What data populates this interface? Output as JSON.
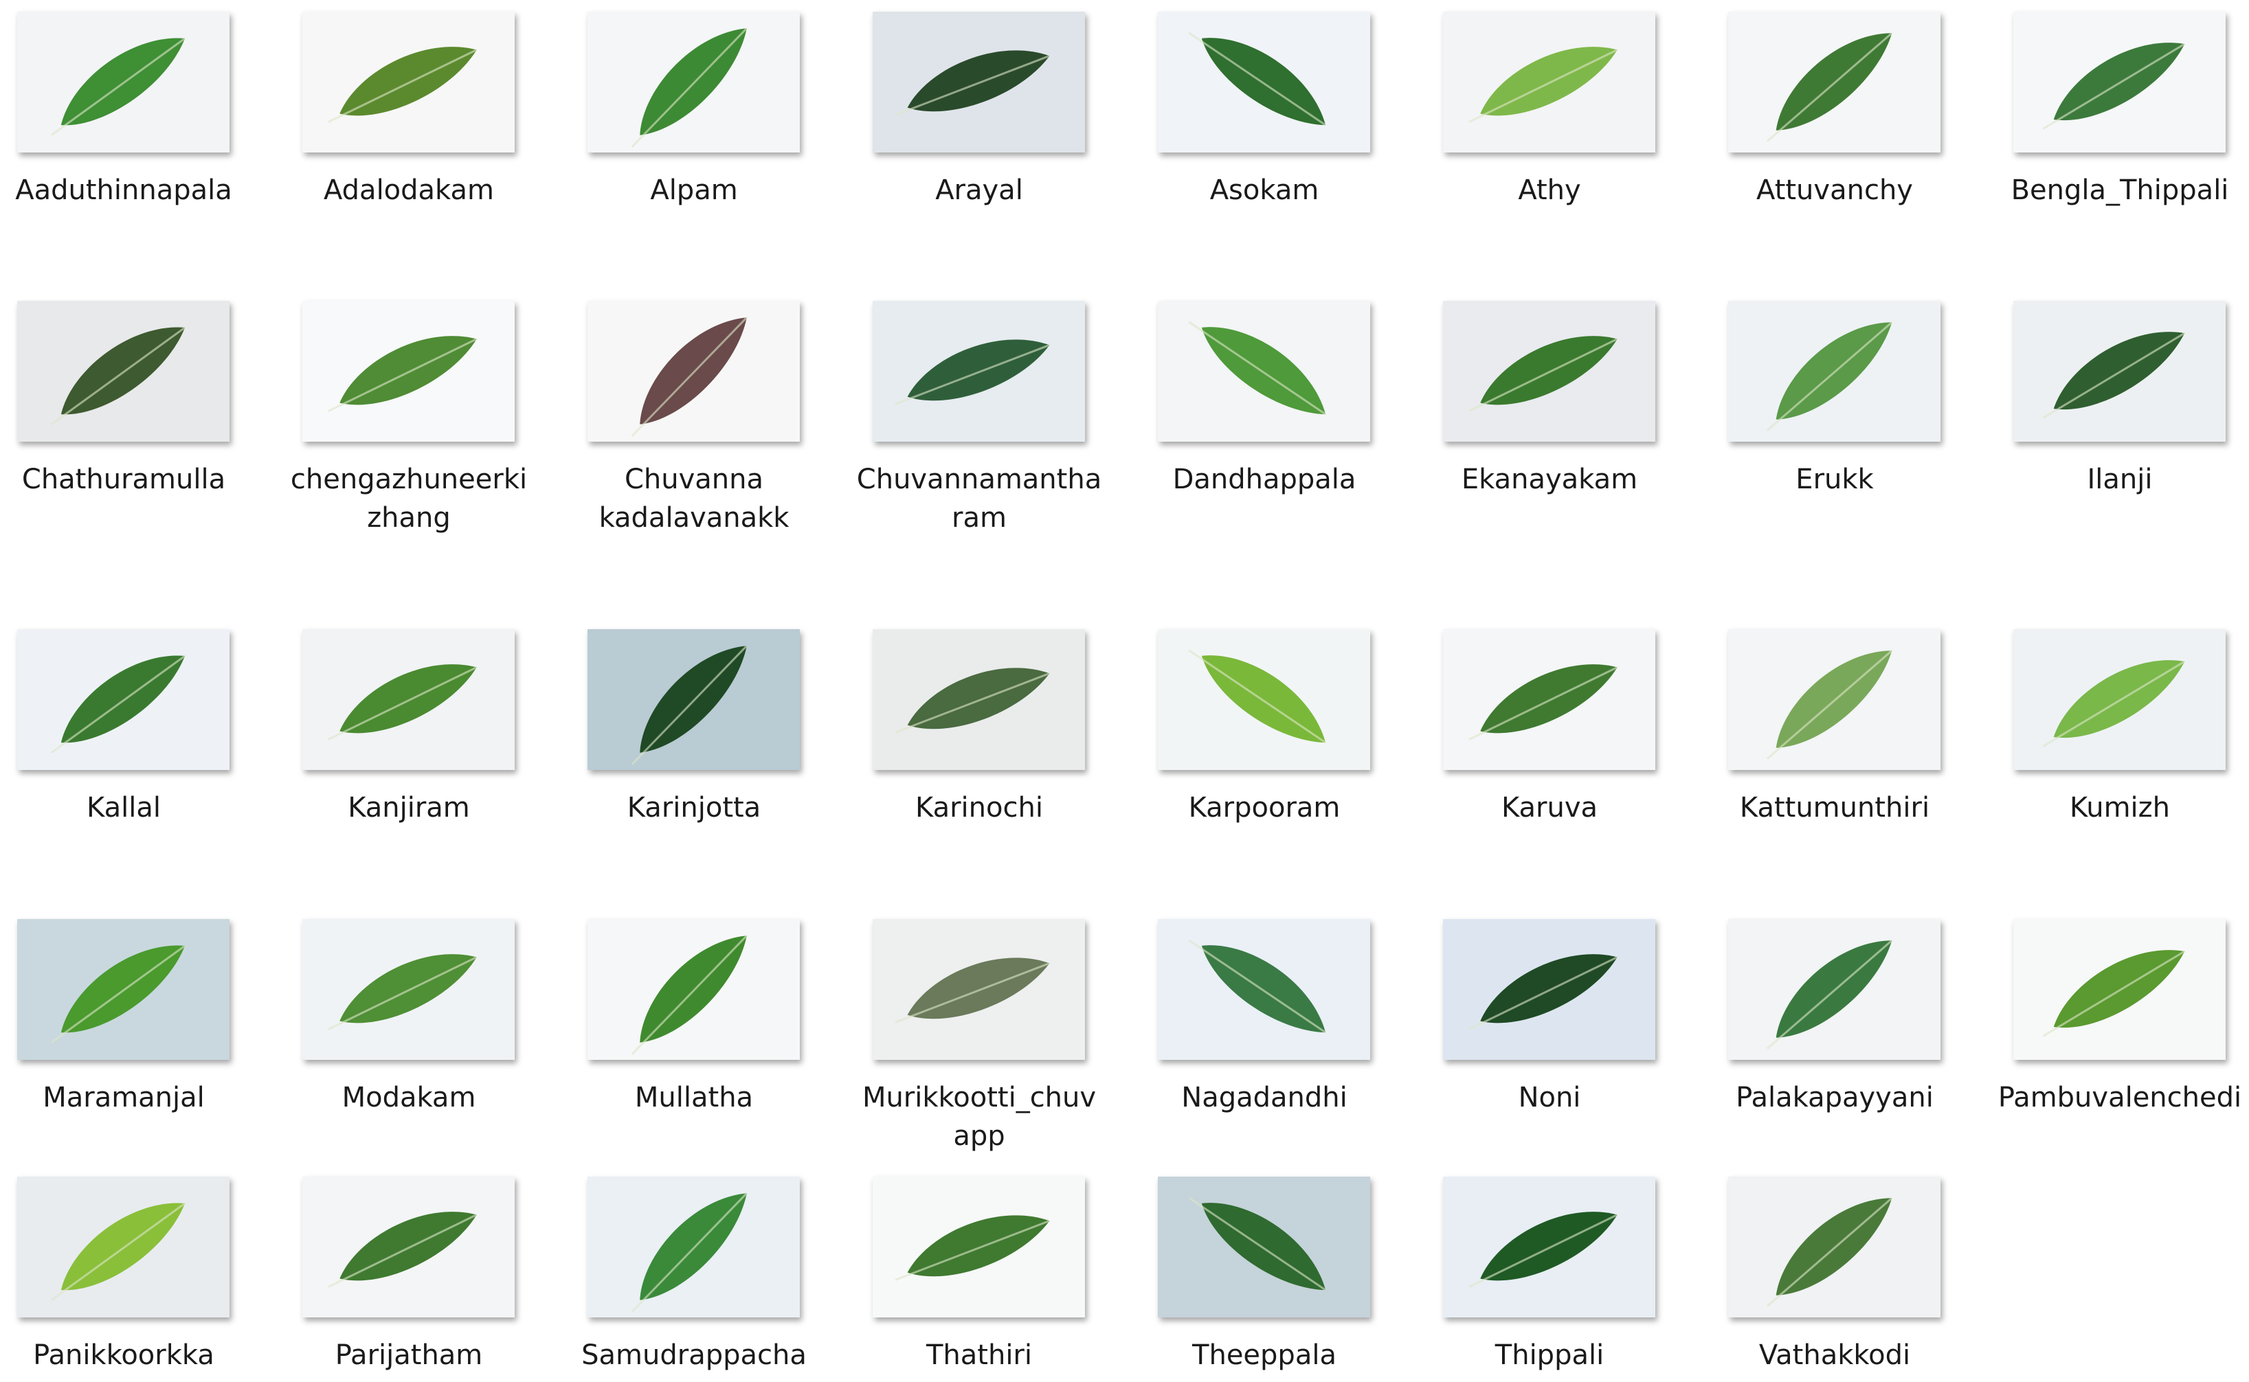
{
  "folder_items": [
    {
      "label_lines": [
        "Aaduthinnapala"
      ],
      "leaf": "#3f8f35",
      "bg": "#f3f4f6"
    },
    {
      "label_lines": [
        "Adalodakam"
      ],
      "leaf": "#5b8a2e",
      "bg": "#f7f7f7"
    },
    {
      "label_lines": [
        "Alpam"
      ],
      "leaf": "#3d8a34",
      "bg": "#f4f6f7"
    },
    {
      "label_lines": [
        "Arayal"
      ],
      "leaf": "#2a4a2c",
      "bg": "#dfe4ea"
    },
    {
      "label_lines": [
        "Asokam"
      ],
      "leaf": "#2f6f2f",
      "bg": "#f0f3f7"
    },
    {
      "label_lines": [
        "Athy"
      ],
      "leaf": "#7fb84a",
      "bg": "#f3f4f5"
    },
    {
      "label_lines": [
        "Attuvanchy"
      ],
      "leaf": "#3f7a35",
      "bg": "#f5f6f7"
    },
    {
      "label_lines": [
        "Bengla_Thippali"
      ],
      "leaf": "#3c7a3c",
      "bg": "#f5f7f8"
    },
    {
      "label_lines": [
        "Chathuramulla"
      ],
      "leaf": "#3e5a30",
      "bg": "#e8e9ea"
    },
    {
      "label_lines": [
        "chengazhuneerki",
        "zhang"
      ],
      "leaf": "#4f8c35",
      "bg": "#f8f9fa"
    },
    {
      "label_lines": [
        "Chuvanna",
        "kadalavanakk"
      ],
      "leaf": "#6a4a4a",
      "bg": "#f7f7f7"
    },
    {
      "label_lines": [
        "Chuvannamantha",
        "ram"
      ],
      "leaf": "#2f5f3a",
      "bg": "#e6ecf0"
    },
    {
      "label_lines": [
        "Dandhappala"
      ],
      "leaf": "#4f9a3a",
      "bg": "#f3f5f6"
    },
    {
      "label_lines": [
        "Ekanayakam"
      ],
      "leaf": "#3a7a2e",
      "bg": "#e9ebee"
    },
    {
      "label_lines": [
        "Erukk"
      ],
      "leaf": "#5a9a48",
      "bg": "#eef2f5"
    },
    {
      "label_lines": [
        "Ilanji"
      ],
      "leaf": "#2f5f30",
      "bg": "#edf0f2"
    },
    {
      "label_lines": [
        "Kallal"
      ],
      "leaf": "#3a7a30",
      "bg": "#eef2f6"
    },
    {
      "label_lines": [
        "Kanjiram"
      ],
      "leaf": "#4a8a30",
      "bg": "#f1f3f4"
    },
    {
      "label_lines": [
        "Karinjotta"
      ],
      "leaf": "#1f4a25",
      "bg": "#b9cbd3"
    },
    {
      "label_lines": [
        "Karinochi"
      ],
      "leaf": "#4a6a40",
      "bg": "#eaeceb"
    },
    {
      "label_lines": [
        "Karpooram"
      ],
      "leaf": "#7ab83a",
      "bg": "#f2f5f6"
    },
    {
      "label_lines": [
        "Karuva"
      ],
      "leaf": "#3f7a30",
      "bg": "#f4f6f7"
    },
    {
      "label_lines": [
        "Kattumunthiri"
      ],
      "leaf": "#7aa85a",
      "bg": "#f3f5f6"
    },
    {
      "label_lines": [
        "Kumizh"
      ],
      "leaf": "#7ab84a",
      "bg": "#eef2f4"
    },
    {
      "label_lines": [
        "Maramanjal"
      ],
      "leaf": "#4a9a2e",
      "bg": "#c9d8de"
    },
    {
      "label_lines": [
        "Modakam"
      ],
      "leaf": "#4f8f35",
      "bg": "#f0f3f5"
    },
    {
      "label_lines": [
        "Mullatha"
      ],
      "leaf": "#3f8a2e",
      "bg": "#f6f7f8"
    },
    {
      "label_lines": [
        "Murikkootti_chuv",
        "app"
      ],
      "leaf": "#6a7a5a",
      "bg": "#eeefef"
    },
    {
      "label_lines": [
        "Nagadandhi"
      ],
      "leaf": "#3a7a45",
      "bg": "#eaf0f6"
    },
    {
      "label_lines": [
        "Noni"
      ],
      "leaf": "#1f4a25",
      "bg": "#dde6f0"
    },
    {
      "label_lines": [
        "Palakapayyani"
      ],
      "leaf": "#3a7a40",
      "bg": "#f2f4f5"
    },
    {
      "label_lines": [
        "Pambuvalenchedi"
      ],
      "leaf": "#5a9a30",
      "bg": "#f7f8f8"
    },
    {
      "label_lines": [
        "Panikkoorkka"
      ],
      "leaf": "#8abf3a",
      "bg": "#e8ecef"
    },
    {
      "label_lines": [
        "Parijatham"
      ],
      "leaf": "#3f7a30",
      "bg": "#f4f5f6"
    },
    {
      "label_lines": [
        "Samudrappacha"
      ],
      "leaf": "#3a8a3a",
      "bg": "#eaf0f4"
    },
    {
      "label_lines": [
        "Thathiri"
      ],
      "leaf": "#3f7a30",
      "bg": "#f7f8f8"
    },
    {
      "label_lines": [
        "Theeppala"
      ],
      "leaf": "#2f6a30",
      "bg": "#c5d3da"
    },
    {
      "label_lines": [
        "Thippali"
      ],
      "leaf": "#1f5a25",
      "bg": "#e8eef4"
    },
    {
      "label_lines": [
        "Vathakkodi"
      ],
      "leaf": "#4a7a3a",
      "bg": "#f0f2f3"
    }
  ]
}
